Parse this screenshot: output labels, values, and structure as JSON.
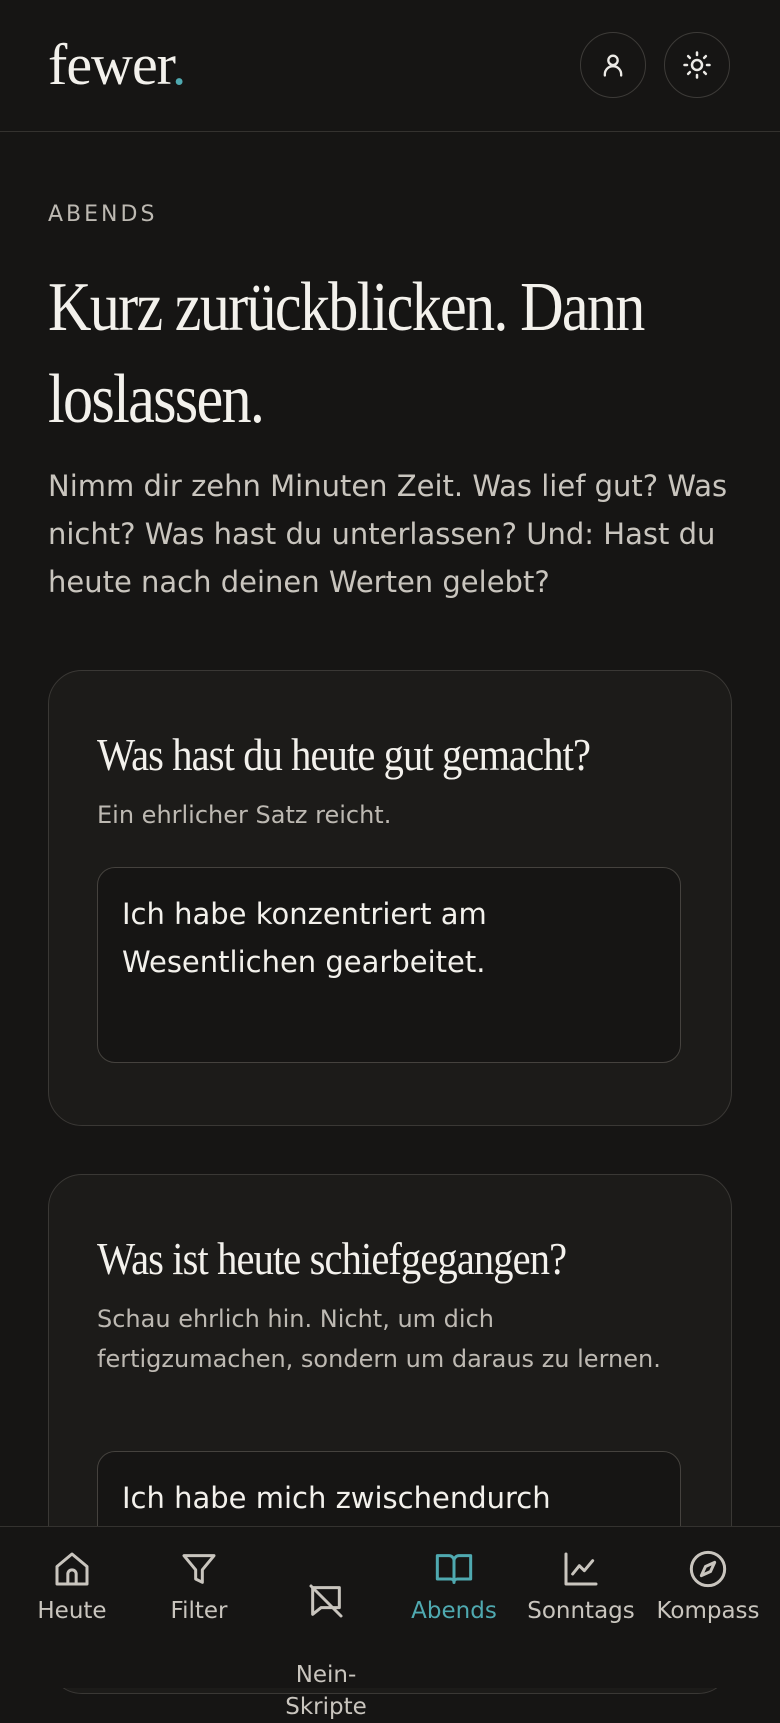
{
  "header": {
    "logo_text": "fewer",
    "logo_dot": ".",
    "profile_icon": "user-icon",
    "theme_icon": "sun-icon"
  },
  "page": {
    "eyebrow": "ABENDS",
    "title_line1": "Kurz zurückblicken. Dann",
    "title_line2": "loslassen.",
    "intro": "Nimm dir zehn Minuten Zeit. Was lief gut? Was nicht? Was hast du unterlassen? Und: Hast du heute nach deinen Werten gelebt?"
  },
  "cards": [
    {
      "question": "Was hast du heute gut gemacht?",
      "hint": "Ein ehrlicher Satz reicht.",
      "answer": "Ich habe konzentriert am Wesentlichen gearbeitet."
    },
    {
      "question": "Was ist heute schiefgegangen?",
      "hint": "Schau ehrlich hin. Nicht, um dich fertigzumachen, sondern um daraus zu lernen.",
      "answer": "Ich habe mich zwischendurch"
    }
  ],
  "nav": {
    "items": [
      {
        "label": "Heute",
        "icon": "home-icon"
      },
      {
        "label": "Filter",
        "icon": "filter-icon"
      },
      {
        "label": "Nein-\nSkripte",
        "icon": "message-off-icon"
      },
      {
        "label": "Abends",
        "icon": "book-open-icon"
      },
      {
        "label": "Sonntags",
        "icon": "chart-line-icon"
      },
      {
        "label": "Kompass",
        "icon": "compass-icon"
      }
    ],
    "active": "Abends",
    "accent_color": "#4fa9b0"
  }
}
